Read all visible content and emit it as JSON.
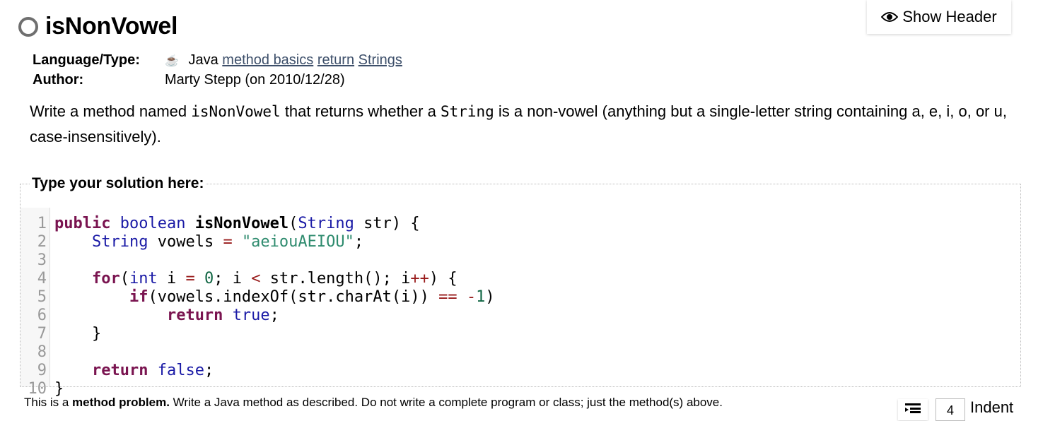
{
  "header": {
    "title": "isNonVowel",
    "show_header_label": "Show Header"
  },
  "meta": {
    "language_label": "Language/Type:",
    "language": "Java",
    "tags": [
      "method basics",
      "return",
      "Strings"
    ],
    "author_label": "Author:",
    "author": "Marty Stepp (on 2010/12/28)"
  },
  "description": {
    "part1": "Write a method named ",
    "code1": "isNonVowel",
    "part2": " that returns whether a ",
    "code2": "String",
    "part3": " is a non-vowel (anything but a single-letter string containing a, e, i, o, or u, case-insensitively)."
  },
  "solution": {
    "legend": "Type your solution here:",
    "line_numbers": [
      "1",
      "2",
      "3",
      "4",
      "5",
      "6",
      "7",
      "8",
      "9",
      "10"
    ]
  },
  "footer": {
    "note_prefix": "This is a ",
    "note_bold": "method problem.",
    "note_rest": " Write a Java method as described. Do not write a complete program or class; just the method(s) above.",
    "indent_value": "4",
    "indent_label": "Indent"
  }
}
